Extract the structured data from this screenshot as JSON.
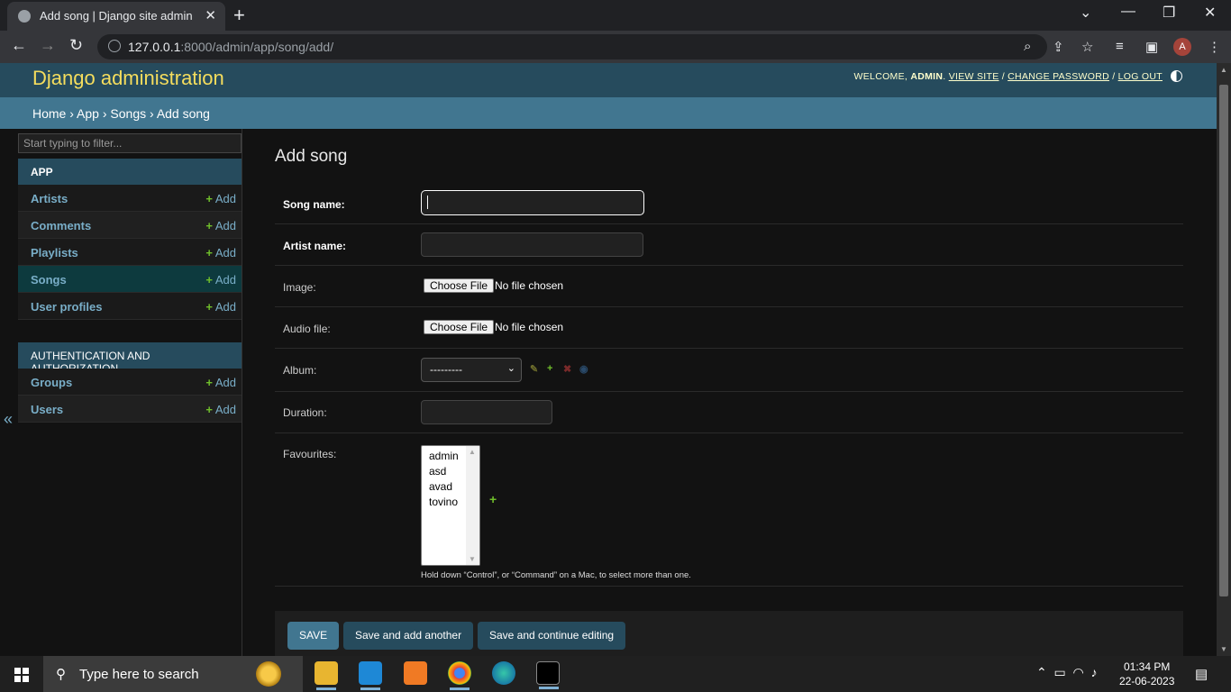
{
  "browser": {
    "tab_title": "Add song | Django site admin",
    "tab_close": "✕",
    "new_tab": "+",
    "url_host": "127.0.0.1",
    "url_path": ":8000/admin/app/song/add/"
  },
  "header": {
    "branding": "Django administration",
    "welcome": "WELCOME,",
    "user": "ADMIN",
    "view_site": "VIEW SITE",
    "change_password": "CHANGE PASSWORD",
    "log_out": "LOG OUT"
  },
  "breadcrumbs": {
    "home": "Home",
    "app": "App",
    "model": "Songs",
    "current": "Add song",
    "sep": "›"
  },
  "sidebar": {
    "filter_placeholder": "Start typing to filter...",
    "add_label": "Add",
    "modules": [
      {
        "caption": "App",
        "items": [
          "Artists",
          "Comments",
          "Playlists",
          "Songs",
          "User profiles"
        ]
      },
      {
        "caption": "Authentication and Authorization",
        "items": [
          "Groups",
          "Users"
        ]
      }
    ],
    "collapse": "«"
  },
  "content": {
    "title": "Add song",
    "fields": {
      "song_name": "Song name:",
      "artist_name": "Artist name:",
      "image": "Image:",
      "audio_file": "Audio file:",
      "album": "Album:",
      "duration": "Duration:",
      "favourites": "Favourites:"
    },
    "choose_file": "Choose File",
    "no_file": "No file chosen",
    "album_selected": "---------",
    "favourites_options": [
      "admin",
      "asd",
      "avad",
      "tovino"
    ],
    "help_text": "Hold down “Control”, or “Command” on a Mac, to select more than one.",
    "buttons": {
      "save": "SAVE",
      "save_add_another": "Save and add another",
      "save_continue": "Save and continue editing"
    }
  },
  "taskbar": {
    "search_placeholder": "Type here to search",
    "time": "01:34 PM",
    "date": "22-06-2023"
  },
  "colors": {
    "header_bg": "#264b5d",
    "breadcrumbs_bg": "#417690",
    "brand_yellow": "#f5dd5d",
    "link": "#79aec8",
    "add_green": "#70bf2b"
  }
}
